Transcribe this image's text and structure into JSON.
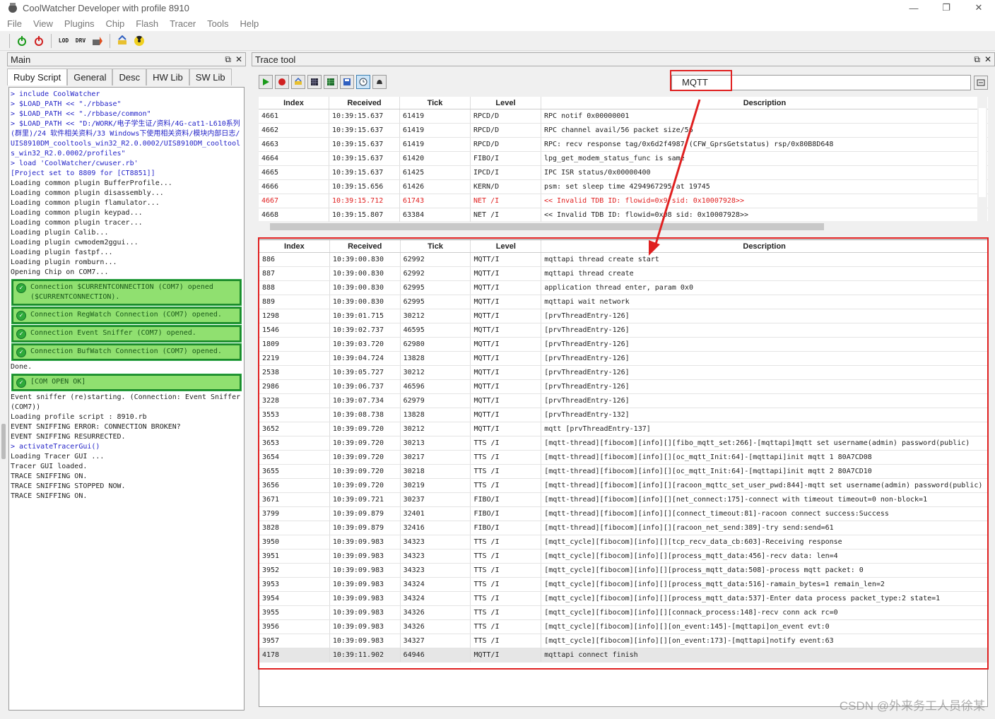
{
  "window": {
    "title": "CoolWatcher Developer with profile 8910",
    "minimize": "—",
    "restore": "❐",
    "close": "✕"
  },
  "menu": [
    "File",
    "View",
    "Plugins",
    "Chip",
    "Flash",
    "Tracer",
    "Tools",
    "Help"
  ],
  "toolbar": {
    "b1": "LOD",
    "b2": "DRV"
  },
  "main_panel": {
    "title": "Main",
    "tabs": [
      "Ruby Script",
      "General",
      "Desc",
      "HW Lib",
      "SW Lib"
    ],
    "active_tab": "Ruby Script",
    "console_top": [
      {
        "type": "cmd",
        "text": "> include CoolWatcher"
      },
      {
        "type": "cmd",
        "text": "> $LOAD_PATH << \"./rbbase\""
      },
      {
        "type": "cmd",
        "text": "> $LOAD_PATH << \"./rbbase/common\""
      },
      {
        "type": "cmd",
        "text": "> $LOAD_PATH << \"D:/WORK/电子学生证/资料/4G-cat1-L610系列(群里)/24 软件相关资料/33 Windows下使用相关资料/模块内部日志/UIS8910DM_cooltools_win32_R2.0.0002/UIS8910DM_cooltools_win32_R2.0.0002/profiles\""
      },
      {
        "type": "cmd",
        "text": "> load 'CoolWatcher/cwuser.rb'"
      },
      {
        "type": "cmd",
        "text": "[Project set to 8809 for [CT8851]]"
      },
      {
        "type": "plain",
        "text": "Loading common plugin BufferProfile..."
      },
      {
        "type": "plain",
        "text": "Loading common plugin disassembly..."
      },
      {
        "type": "plain",
        "text": "Loading common plugin flamulator..."
      },
      {
        "type": "plain",
        "text": "Loading common plugin keypad..."
      },
      {
        "type": "plain",
        "text": "Loading common plugin tracer..."
      },
      {
        "type": "plain",
        "text": "Loading plugin Calib..."
      },
      {
        "type": "plain",
        "text": "Loading plugin cwmodem2ggui..."
      },
      {
        "type": "plain",
        "text": "Loading plugin fastpf..."
      },
      {
        "type": "plain",
        "text": "Loading plugin romburn..."
      },
      {
        "type": "plain",
        "text": "Opening Chip on COM7..."
      }
    ],
    "connections": [
      "Connection $CURRENTCONNECTION (COM7) opened ($CURRENTCONNECTION).",
      "Connection RegWatch Connection (COM7) opened.",
      "Connection Event Sniffer (COM7) opened.",
      "Connection BufWatch Connection (COM7) opened."
    ],
    "done_text": "Done.",
    "com_ok": "[COM OPEN OK]",
    "console_bottom": [
      {
        "type": "plain",
        "text": "Event sniffer (re)starting. (Connection: Event Sniffer (COM7))"
      },
      {
        "type": "plain",
        "text": "Loading profile script : 8910.rb"
      },
      {
        "type": "plain",
        "text": "EVENT SNIFFING ERROR: CONNECTION BROKEN?"
      },
      {
        "type": "plain",
        "text": "EVENT SNIFFING RESURRECTED."
      },
      {
        "type": "cmd",
        "text": "> activateTracerGui()"
      },
      {
        "type": "plain",
        "text": "Loading Tracer GUI ..."
      },
      {
        "type": "plain",
        "text": "Tracer GUI loaded."
      },
      {
        "type": "plain",
        "text": "TRACE SNIFFING ON."
      },
      {
        "type": "plain",
        "text": "TRACE SNIFFING STOPPED NOW."
      },
      {
        "type": "plain",
        "text": "TRACE SNIFFING ON."
      }
    ]
  },
  "trace_panel": {
    "title": "Trace tool",
    "filter_value": "MQTT",
    "columns": [
      "Index",
      "Received",
      "Tick",
      "Level",
      "Description"
    ],
    "top_rows": [
      [
        "4661",
        "10:39:15.637",
        "61419",
        "RPCD/D",
        "RPC notif 0x00000001",
        ""
      ],
      [
        "4662",
        "10:39:15.637",
        "61419",
        "RPCD/D",
        "RPC channel avail/56 packet size/56",
        ""
      ],
      [
        "4663",
        "10:39:15.637",
        "61419",
        "RPCD/D",
        "RPC: recv response tag/0x6d2f4987 (CFW_GprsGetstatus) rsp/0x80B8D648",
        ""
      ],
      [
        "4664",
        "10:39:15.637",
        "61420",
        "FIBO/I",
        "lpg_get_modem_status_func is same",
        ""
      ],
      [
        "4665",
        "10:39:15.637",
        "61425",
        "IPCD/I",
        "IPC ISR status/0x00000400",
        ""
      ],
      [
        "4666",
        "10:39:15.656",
        "61426",
        "KERN/D",
        "psm: set sleep time 4294967295 at 19745",
        ""
      ],
      [
        "4667",
        "10:39:15.712",
        "61743",
        "NET /I",
        "<< Invalid TDB ID: flowid=0x9 sid: 0x10007928>>",
        "alert"
      ],
      [
        "4668",
        "10:39:15.807",
        "63384",
        "NET /I",
        "<< Invalid TDB ID: flowid=0x08 sid: 0x10007928>>",
        ""
      ]
    ],
    "filtered_rows": [
      [
        "886",
        "10:39:00.830",
        "62992",
        "MQTT/I",
        "mqttapi thread create start"
      ],
      [
        "887",
        "10:39:00.830",
        "62992",
        "MQTT/I",
        "mqttapi thread create"
      ],
      [
        "888",
        "10:39:00.830",
        "62995",
        "MQTT/I",
        "application thread enter, param 0x0"
      ],
      [
        "889",
        "10:39:00.830",
        "62995",
        "MQTT/I",
        "mqttapi wait network"
      ],
      [
        "1298",
        "10:39:01.715",
        "30212",
        "MQTT/I",
        "[prvThreadEntry-126]"
      ],
      [
        "1546",
        "10:39:02.737",
        "46595",
        "MQTT/I",
        "[prvThreadEntry-126]"
      ],
      [
        "1809",
        "10:39:03.720",
        "62980",
        "MQTT/I",
        "[prvThreadEntry-126]"
      ],
      [
        "2219",
        "10:39:04.724",
        "13828",
        "MQTT/I",
        "[prvThreadEntry-126]"
      ],
      [
        "2538",
        "10:39:05.727",
        "30212",
        "MQTT/I",
        "[prvThreadEntry-126]"
      ],
      [
        "2986",
        "10:39:06.737",
        "46596",
        "MQTT/I",
        "[prvThreadEntry-126]"
      ],
      [
        "3228",
        "10:39:07.734",
        "62979",
        "MQTT/I",
        "[prvThreadEntry-126]"
      ],
      [
        "3553",
        "10:39:08.738",
        "13828",
        "MQTT/I",
        "[prvThreadEntry-132]"
      ],
      [
        "3652",
        "10:39:09.720",
        "30212",
        "MQTT/I",
        "mqtt [prvThreadEntry-137]"
      ],
      [
        "3653",
        "10:39:09.720",
        "30213",
        "TTS /I",
        "[mqtt-thread][fibocom][info][][fibo_mqtt_set:266]-[mqttapi]mqtt set username(admin) password(public)"
      ],
      [
        "3654",
        "10:39:09.720",
        "30217",
        "TTS /I",
        "[mqtt-thread][fibocom][info][][oc_mqtt_Init:64]-[mqttapi]init mqtt 1 80A7CD08"
      ],
      [
        "3655",
        "10:39:09.720",
        "30218",
        "TTS /I",
        "[mqtt-thread][fibocom][info][][oc_mqtt_Init:64]-[mqttapi]init mqtt 2 80A7CD10"
      ],
      [
        "3656",
        "10:39:09.720",
        "30219",
        "TTS /I",
        "[mqtt-thread][fibocom][info][][racoon_mqttc_set_user_pwd:844]-mqtt set username(admin) password(public)"
      ],
      [
        "3671",
        "10:39:09.721",
        "30237",
        "FIBO/I",
        "[mqtt-thread][fibocom][info][][net_connect:175]-connect with timeout timeout=0 non-block=1"
      ],
      [
        "3799",
        "10:39:09.879",
        "32401",
        "FIBO/I",
        "[mqtt-thread][fibocom][info][][connect_timeout:81]-racoon connect success:Success"
      ],
      [
        "3828",
        "10:39:09.879",
        "32416",
        "FIBO/I",
        "[mqtt-thread][fibocom][info][][racoon_net_send:389]-try send:send=61"
      ],
      [
        "3950",
        "10:39:09.983",
        "34323",
        "TTS /I",
        "[mqtt_cycle][fibocom][info][][tcp_recv_data_cb:603]-Receiving response"
      ],
      [
        "3951",
        "10:39:09.983",
        "34323",
        "TTS /I",
        "[mqtt_cycle][fibocom][info][][process_mqtt_data:456]-recv data: len=4"
      ],
      [
        "3952",
        "10:39:09.983",
        "34323",
        "TTS /I",
        "[mqtt_cycle][fibocom][info][][process_mqtt_data:508]-process mqtt packet: 0"
      ],
      [
        "3953",
        "10:39:09.983",
        "34324",
        "TTS /I",
        "[mqtt_cycle][fibocom][info][][process_mqtt_data:516]-ramain_bytes=1 remain_len=2"
      ],
      [
        "3954",
        "10:39:09.983",
        "34324",
        "TTS /I",
        "[mqtt_cycle][fibocom][info][][process_mqtt_data:537]-Enter data process packet_type:2 state=1"
      ],
      [
        "3955",
        "10:39:09.983",
        "34326",
        "TTS /I",
        "[mqtt_cycle][fibocom][info][][connack_process:148]-recv conn ack rc=0"
      ],
      [
        "3956",
        "10:39:09.983",
        "34326",
        "TTS /I",
        "[mqtt_cycle][fibocom][info][][on_event:145]-[mqttapi]on_event evt:0"
      ],
      [
        "3957",
        "10:39:09.983",
        "34327",
        "TTS /I",
        "[mqtt_cycle][fibocom][info][][on_event:173]-[mqttapi]notify event:63"
      ],
      [
        "4178",
        "10:39:11.902",
        "64946",
        "MQTT/I",
        "mqttapi connect finish"
      ]
    ]
  },
  "watermark": "CSDN @外来务工人员徐某"
}
